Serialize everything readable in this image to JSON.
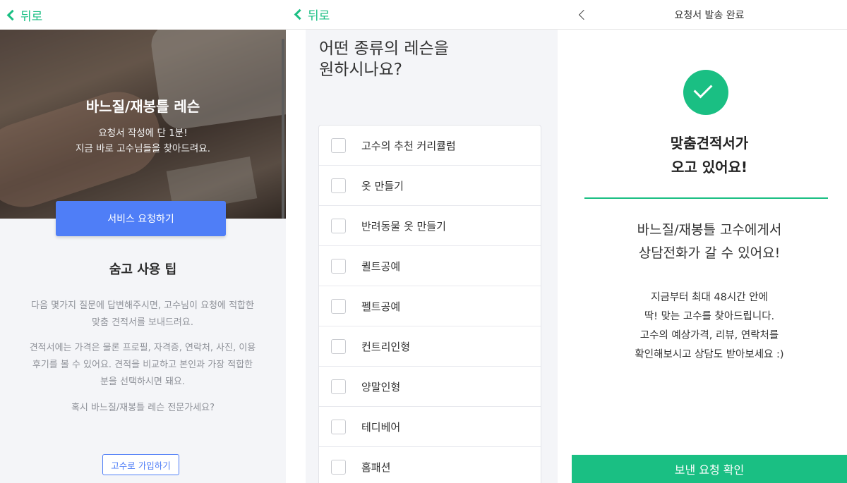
{
  "panel1": {
    "back_label": "뒤로",
    "hero_title": "바느질/재봉틀 레슨",
    "hero_sub_line1": "요청서 작성에 단 1분!",
    "hero_sub_line2": "지금 바로 고수님들을 찾아드려요.",
    "request_button": "서비스 요청하기",
    "tips_title": "숨고 사용 팁",
    "tips_p1_line1": "다음 몇가지 질문에 답변해주시면, 고수님이 요청에 적합한",
    "tips_p1_line2": "맞춤 견적서를 보내드려요.",
    "tips_p2_line1": "견적서에는 가격은 물론 프로필, 자격증, 연락처, 사진, 이용",
    "tips_p2_line2": "후기를 볼 수 있어요. 견적을 비교하고 본인과 가장 적합한",
    "tips_p2_line3": "분을 선택하시면 돼요.",
    "pro_question": "혹시 바느질/재봉틀 레슨 전문가세요?",
    "join_button": "고수로 가입하기"
  },
  "panel2": {
    "back_label": "뒤로",
    "question_line1": "어떤 종류의 레슨을",
    "question_line2": "원하시나요?",
    "options": [
      {
        "label": "고수의 추천 커리큘럼",
        "checked": false
      },
      {
        "label": "옷 만들기",
        "checked": false
      },
      {
        "label": "반려동물 옷 만들기",
        "checked": false
      },
      {
        "label": "퀼트공예",
        "checked": false
      },
      {
        "label": "펠트공예",
        "checked": false
      },
      {
        "label": "컨트리인형",
        "checked": false
      },
      {
        "label": "양말인형",
        "checked": false
      },
      {
        "label": "테디베어",
        "checked": false
      },
      {
        "label": "홈패션",
        "checked": false
      }
    ]
  },
  "panel3": {
    "title": "요청서 발송 완료",
    "done_line1": "맞춤견적서가",
    "done_line2": "오고 있어요!",
    "call_line1": "바느질/재봉틀 고수에게서",
    "call_line2": "상담전화가 갈 수 있어요!",
    "info_line1": "지금부터 최대 48시간 안에",
    "info_line2": "딱! 맞는 고수를 찾아드립니다.",
    "info_line3": "고수의 예상가격, 리뷰, 연락처를",
    "info_line4": "확인해보시고 상담도 받아보세요 :)",
    "confirm_button": "보낸 요청 확인"
  },
  "colors": {
    "brand_green": "#1abf83",
    "brand_blue": "#4f7ef7",
    "muted_text": "#8f9299"
  },
  "icons": [
    "chevron-left-icon",
    "checkmark-icon",
    "checkbox-icon"
  ]
}
